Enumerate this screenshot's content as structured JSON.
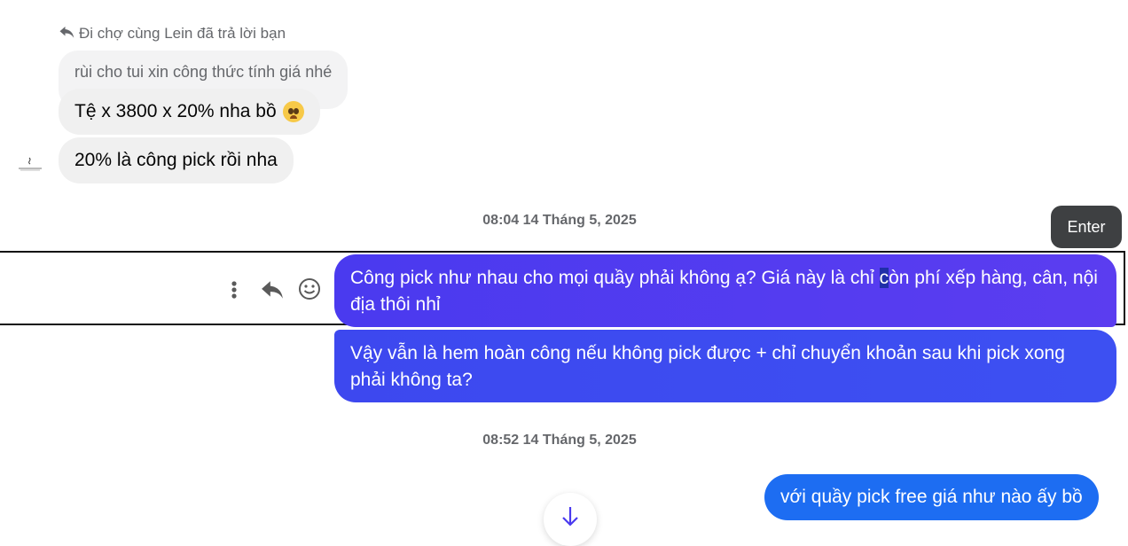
{
  "reply_header": {
    "text": "Đi chợ cùng Lein đã trả lời bạn",
    "icon": "reply-icon"
  },
  "quoted_message": {
    "text": "rùi cho tui xin công thức tính giá nhé"
  },
  "incoming_messages": [
    {
      "text": "Tệ x 3800 x 20% nha bồ",
      "emoji": "pleading-face-emoji"
    },
    {
      "text": "20% là công pick rồi nha"
    }
  ],
  "timestamps": [
    "08:04 14 Tháng 5, 2025",
    "08:52 14 Tháng 5, 2025"
  ],
  "tooltip": {
    "text": "Enter"
  },
  "message_actions": {
    "more_icon": "more-vertical-icon",
    "reply_icon": "reply-icon",
    "react_icon": "smiley-icon"
  },
  "outgoing_messages": [
    {
      "before_caret": "Công pick như nhau cho mọi quầy phải không ạ? Giá này là chỉ ",
      "caret_char": "c",
      "after_caret": "òn phí xếp hàng, cân, nội địa thôi nhỉ"
    },
    {
      "text": "Vậy vẫn là hem hoàn công nếu không pick được + chỉ chuyển khoản sau khi pick xong phải không ta?"
    },
    {
      "text": "với quầy pick free giá như nào ấy bồ"
    }
  ],
  "scroll_button": {
    "icon": "arrow-down-icon"
  },
  "colors": {
    "incoming_bubble": "#f0f0f0",
    "outgoing_bubble_1": "#4a3aef",
    "outgoing_bubble_2": "#3d48ef",
    "outgoing_bubble_3": "#1d6df2",
    "tooltip_bg": "#3e4042",
    "muted_text": "#65676b"
  }
}
